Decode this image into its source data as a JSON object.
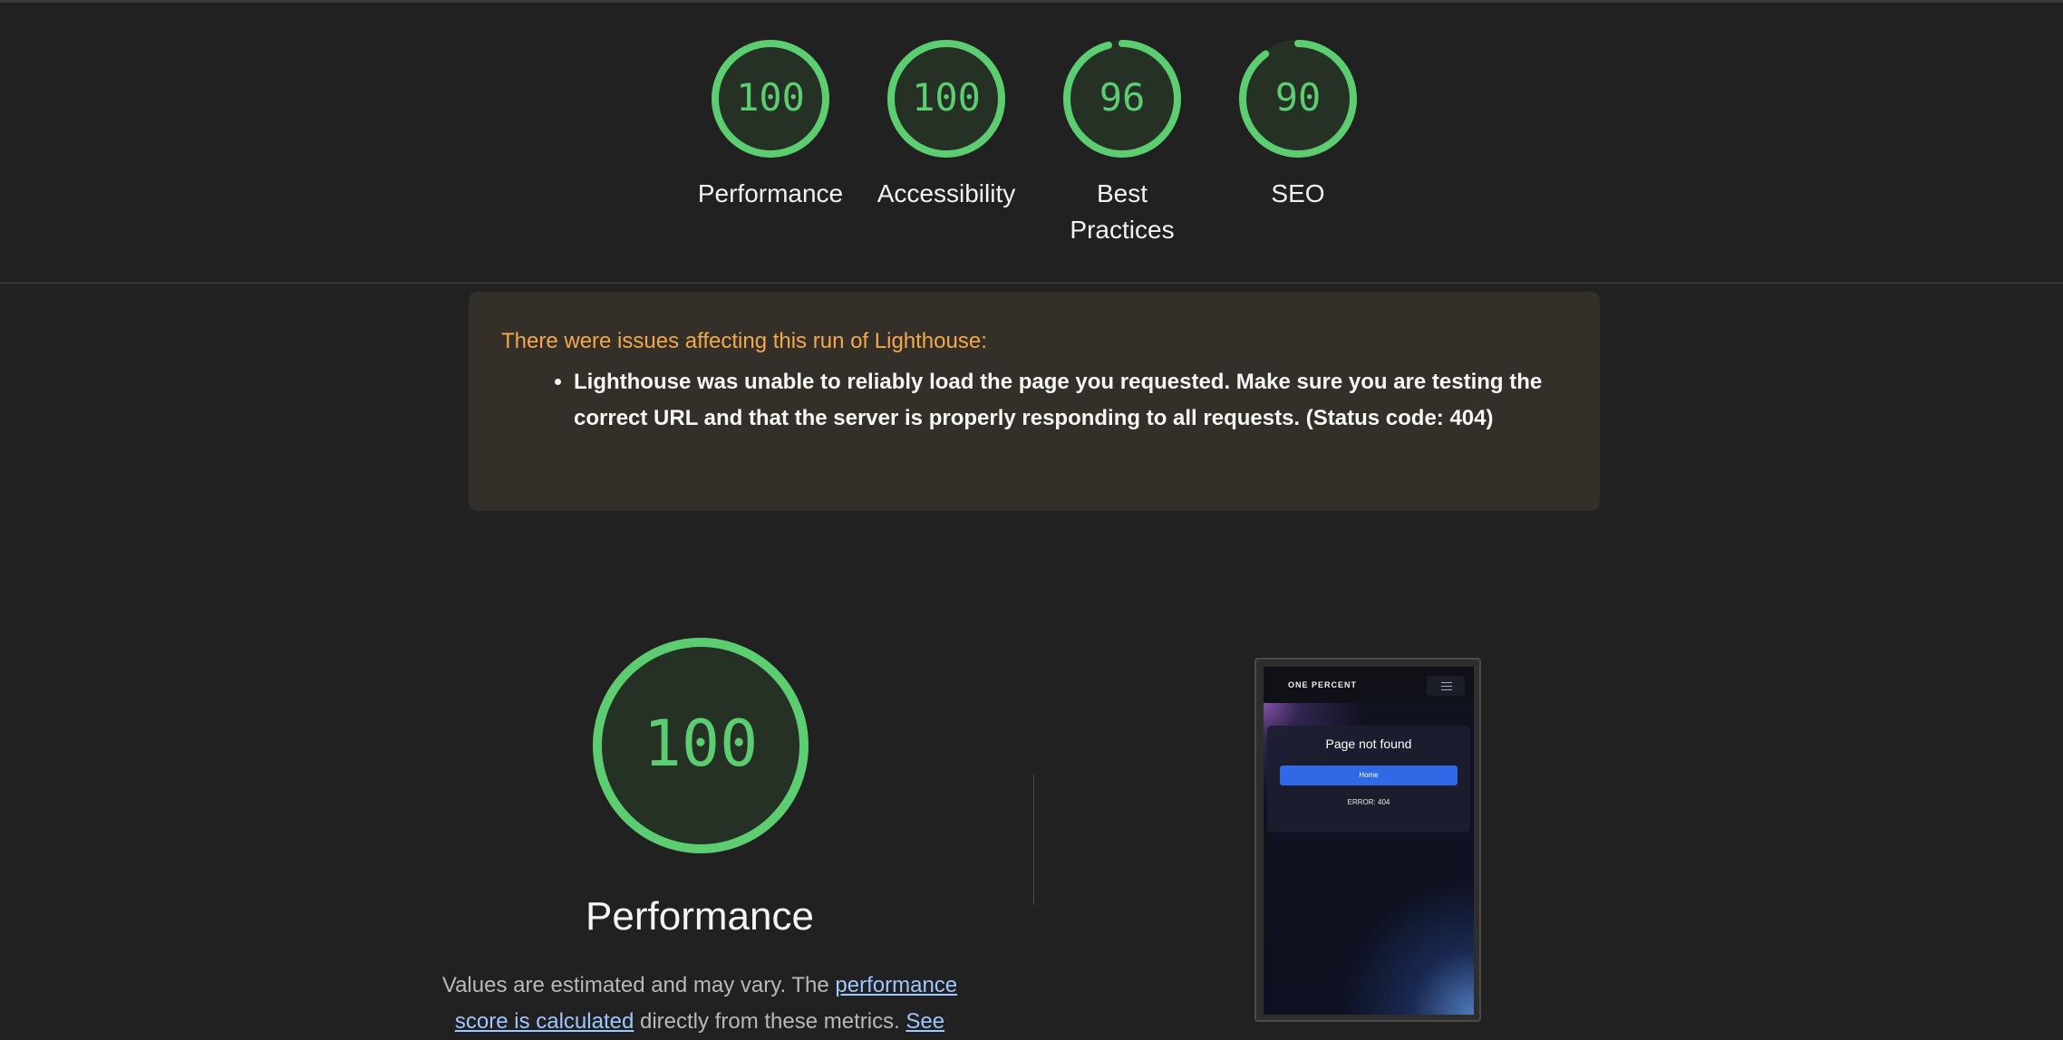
{
  "categories": [
    {
      "score": "100",
      "label": "Performance",
      "fraction": 1.0
    },
    {
      "score": "100",
      "label": "Accessibility",
      "fraction": 1.0
    },
    {
      "score": "96",
      "label": "Best Practices",
      "fraction": 0.96
    },
    {
      "score": "90",
      "label": "SEO",
      "fraction": 0.9
    }
  ],
  "colors": {
    "pass": "#5ccd70",
    "pass_bg": "#263126",
    "warning_text": "#f3a94b",
    "link": "#9fc7ff"
  },
  "warning": {
    "title": "There were issues affecting this run of Lighthouse:",
    "items": [
      "Lighthouse was unable to reliably load the page you requested. Make sure you are testing the correct URL and that the server is properly responding to all requests. (Status code: 404)"
    ]
  },
  "performance": {
    "score": "100",
    "fraction": 1.0,
    "title": "Performance",
    "desc_prefix": "Values are estimated and may vary. The ",
    "desc_link1": "performance score is calculated",
    "desc_middle": " directly from these metrics. ",
    "desc_link2": "See"
  },
  "screenshot": {
    "brand": "ONE PERCENT",
    "heading": "Page not found",
    "button": "Home",
    "error": "ERROR: 404"
  }
}
